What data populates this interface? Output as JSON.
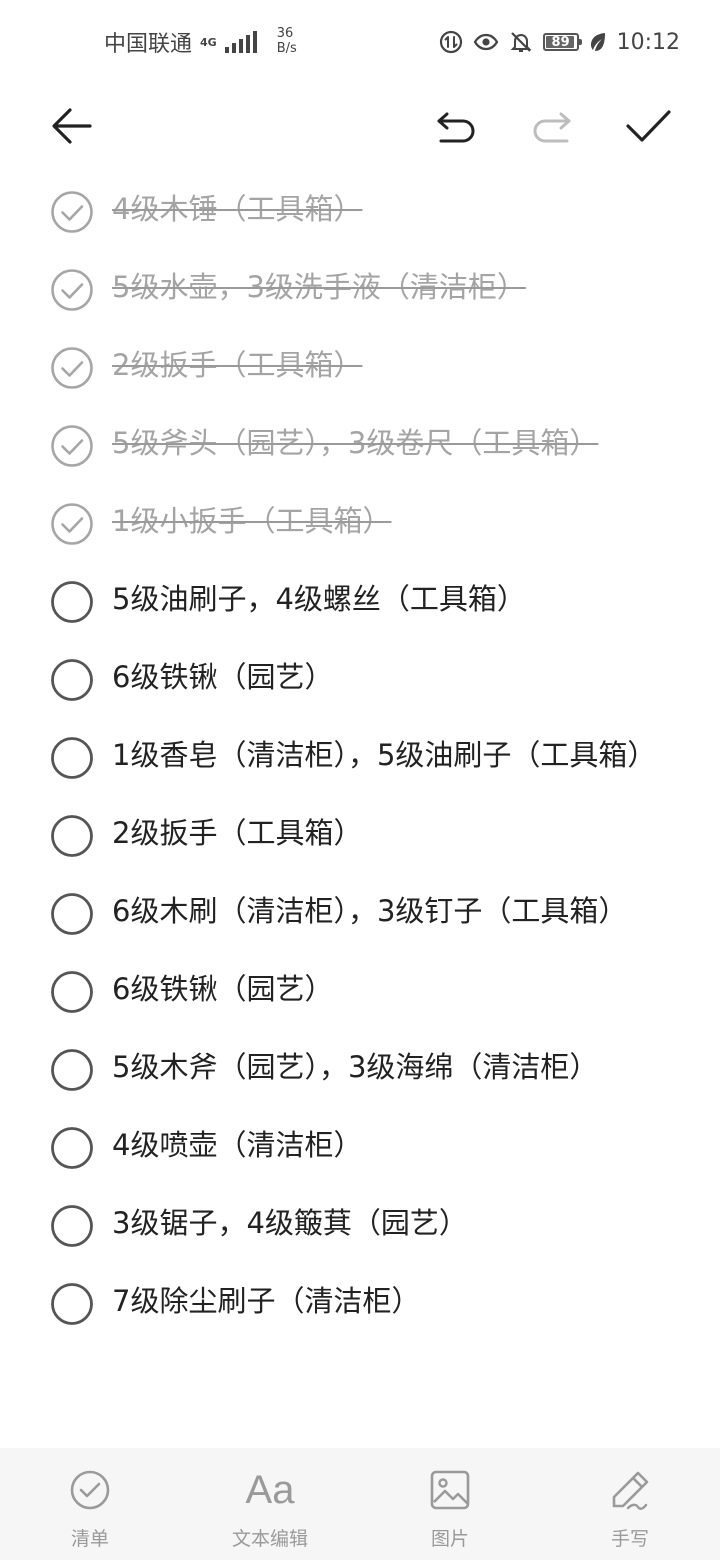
{
  "status_bar": {
    "carrier": "中国联通",
    "network_type": "4G",
    "speed_value": "36",
    "speed_unit": "B/s",
    "battery_level": "89",
    "time": "10:12",
    "icons": [
      "data-saver-icon",
      "eye-comfort-icon",
      "mute-bell-icon",
      "battery-icon",
      "leaf-icon"
    ]
  },
  "toolbar": {
    "icons": [
      "back-arrow-icon",
      "undo-icon",
      "redo-icon",
      "checkmark-icon"
    ],
    "redo_enabled": false
  },
  "checklist": {
    "items": [
      {
        "text": "4级木锤（工具箱）",
        "done": true
      },
      {
        "text": "5级水壶，3级洗手液（清洁柜）",
        "done": true
      },
      {
        "text": "2级扳手（工具箱）",
        "done": true
      },
      {
        "text": "5级斧头（园艺），3级卷尺（工具箱）",
        "done": true
      },
      {
        "text": "1级小扳手（工具箱）",
        "done": true
      },
      {
        "text": "5级油刷子，4级螺丝（工具箱）",
        "done": false
      },
      {
        "text": "6级铁锹（园艺）",
        "done": false
      },
      {
        "text": "1级香皂（清洁柜），5级油刷子（工具箱）",
        "done": false
      },
      {
        "text": "2级扳手（工具箱）",
        "done": false
      },
      {
        "text": "6级木刷（清洁柜），3级钉子（工具箱）",
        "done": false
      },
      {
        "text": "6级铁锹（园艺）",
        "done": false
      },
      {
        "text": "5级木斧（园艺），3级海绵（清洁柜）",
        "done": false
      },
      {
        "text": "4级喷壶（清洁柜）",
        "done": false
      },
      {
        "text": "3级锯子，4级簸萁（园艺）",
        "done": false
      },
      {
        "text": "7级除尘刷子（清洁柜）",
        "done": false
      }
    ]
  },
  "bottom_bar": {
    "checklist_label": "清单",
    "text_edit_label": "文本编辑",
    "text_edit_glyph": "Aa",
    "image_label": "图片",
    "handwriting_label": "手写"
  },
  "colors": {
    "text": "#222222",
    "done_text": "#a4a4a4",
    "icon_gray": "#9a9a9a",
    "bottom_bar_bg": "#f6f6f6"
  }
}
